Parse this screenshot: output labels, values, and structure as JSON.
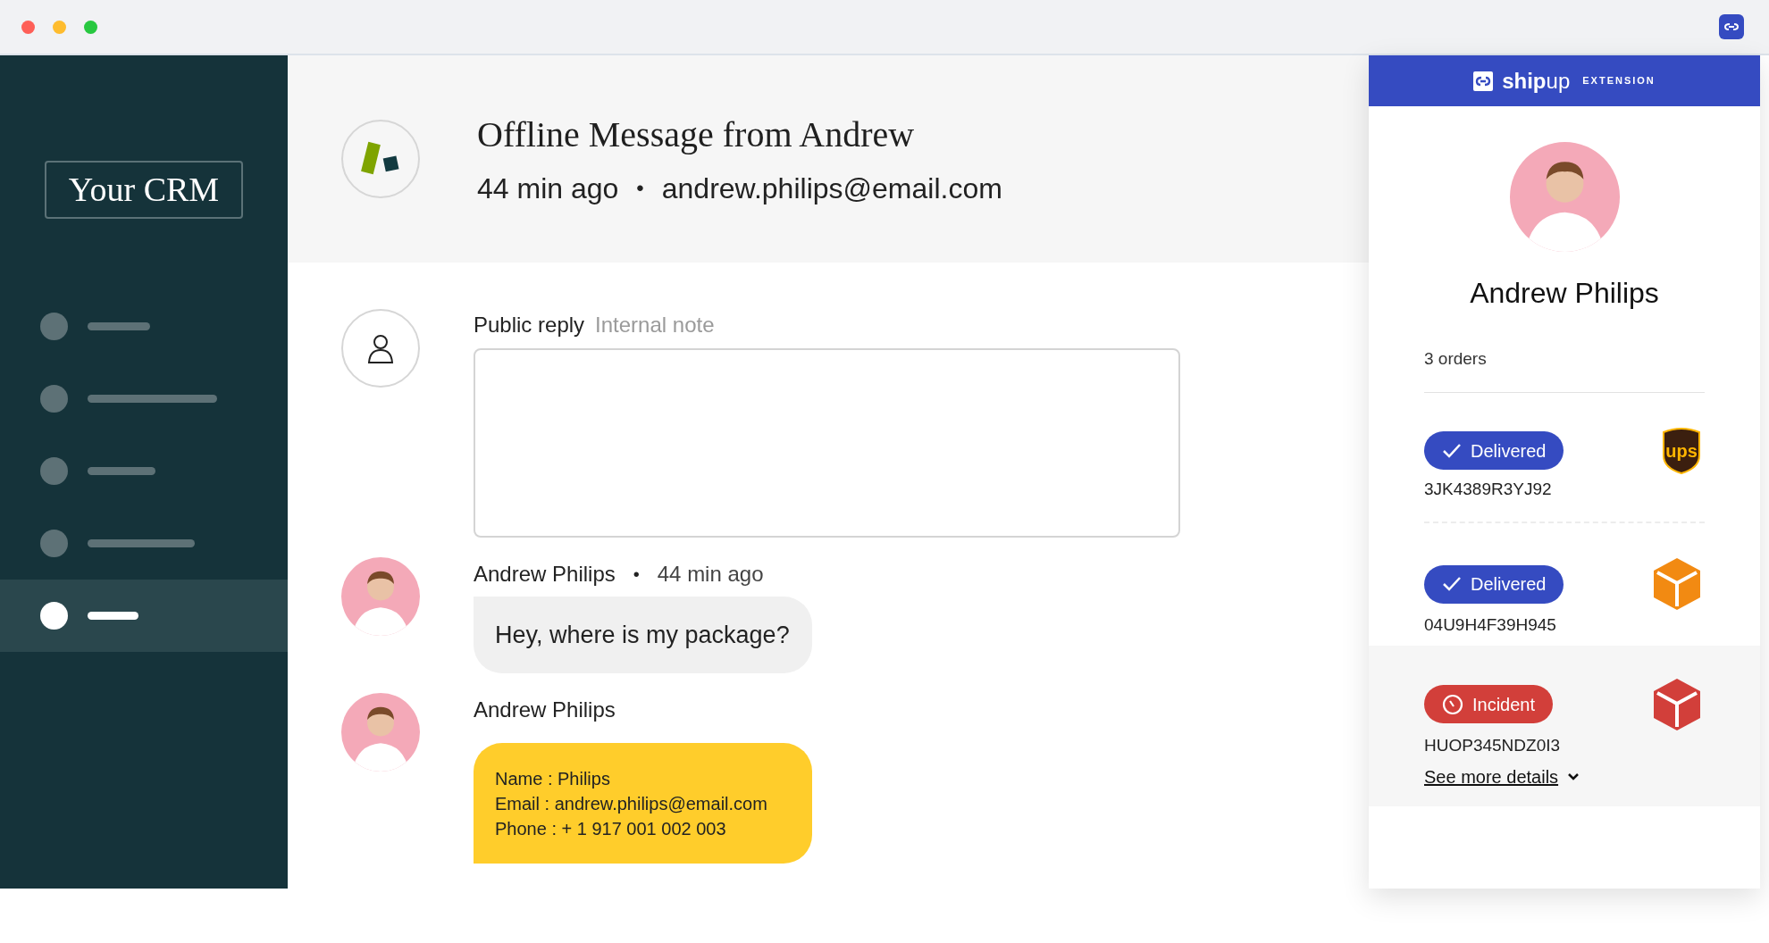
{
  "sidebar": {
    "logo": "Your CRM",
    "items": [
      {
        "selected": false
      },
      {
        "selected": false
      },
      {
        "selected": false
      },
      {
        "selected": false
      },
      {
        "selected": true
      }
    ]
  },
  "ticket": {
    "title": "Offline Message from Andrew",
    "time": "44 min ago",
    "separator": "•",
    "email": "andrew.philips@email.com"
  },
  "reply": {
    "tabs": [
      {
        "label": "Public reply",
        "selected": true
      },
      {
        "label": "Internal note",
        "selected": false
      }
    ]
  },
  "messages": [
    {
      "kind": "bubble",
      "author": "Andrew Philips",
      "separator": "•",
      "time": "44 min ago",
      "lines": [
        "Hey, where is my package?"
      ]
    },
    {
      "kind": "card",
      "author": "Andrew Philips",
      "lines": [
        "Name : Philips",
        "Email : andrew.philips@email.com",
        "Phone : + 1 917 001 002 003"
      ]
    }
  ],
  "extension": {
    "brand": "**ship**up",
    "label": "EXTENSION"
  },
  "customer": {
    "name": "Andrew Philips",
    "orders": "3 orders"
  },
  "orders": [
    {
      "kind": "delivered",
      "status": "Delivered",
      "tracking": "3JK4389R3YJ92",
      "logo": {
        "kind": "shield",
        "text": "ups"
      },
      "highlighted": false
    },
    {
      "kind": "delivered",
      "status": "Delivered",
      "tracking": "04U9H4F39H945",
      "logo": {
        "kind": "box",
        "color": "#f28a12"
      },
      "highlighted": false
    },
    {
      "kind": "incident",
      "status": "Incident",
      "tracking": "HUOP345NDZ0I3",
      "logo": {
        "kind": "box",
        "color": "#d23f3a"
      },
      "highlighted": true,
      "link": "See more details"
    }
  ]
}
